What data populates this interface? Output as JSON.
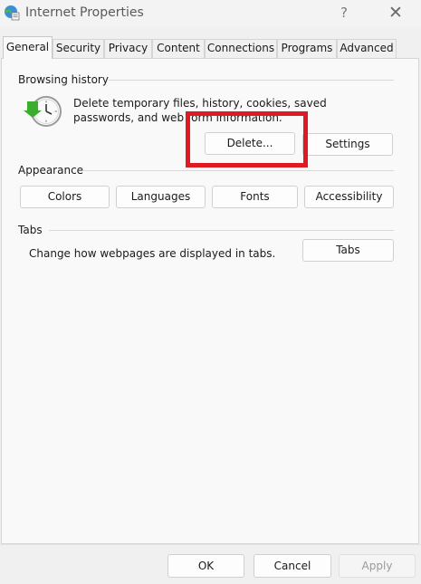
{
  "window": {
    "title": "Internet Properties",
    "help_glyph": "?",
    "close_glyph": "✕",
    "app_icon": "internet-options-icon"
  },
  "tabs": [
    {
      "label": "General",
      "active": true
    },
    {
      "label": "Security",
      "active": false
    },
    {
      "label": "Privacy",
      "active": false
    },
    {
      "label": "Content",
      "active": false
    },
    {
      "label": "Connections",
      "active": false
    },
    {
      "label": "Programs",
      "active": false
    },
    {
      "label": "Advanced",
      "active": false
    }
  ],
  "browsing_history": {
    "title": "Browsing history",
    "description": "Delete temporary files, history, cookies, saved passwords, and web form information.",
    "delete_label": "Delete...",
    "settings_label": "Settings",
    "icon": "history-clock-icon"
  },
  "appearance": {
    "title": "Appearance",
    "colors_label": "Colors",
    "languages_label": "Languages",
    "fonts_label": "Fonts",
    "accessibility_label": "Accessibility"
  },
  "tabs_section": {
    "title": "Tabs",
    "description": "Change how webpages are displayed in tabs.",
    "tabs_button_label": "Tabs"
  },
  "footer": {
    "ok_label": "OK",
    "cancel_label": "Cancel",
    "apply_label": "Apply",
    "apply_disabled": true
  },
  "colors": {
    "highlight": "#e01a22",
    "history_arrow": "#3cae2f"
  }
}
